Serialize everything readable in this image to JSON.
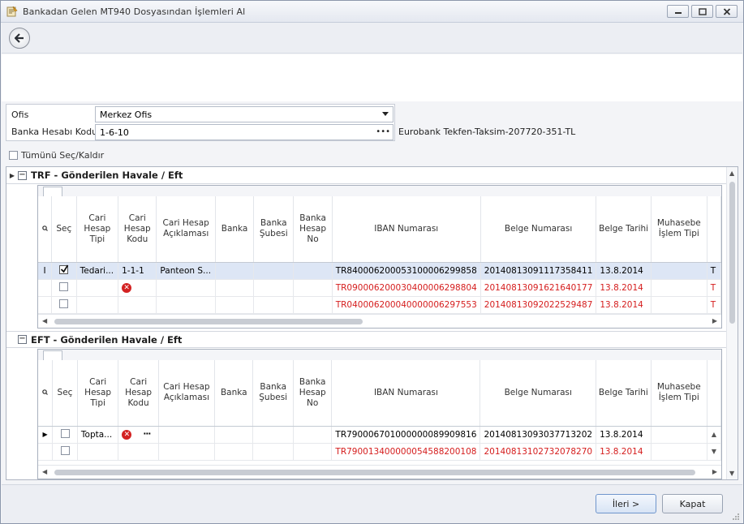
{
  "window": {
    "title": "Bankadan Gelen MT940 Dosyasından İşlemleri Al",
    "minimize": "—",
    "maximize": "□",
    "close": "✕"
  },
  "form": {
    "office_label": "Ofis",
    "office_value": "Merkez Ofis",
    "bank_account_label": "Banka Hesabı Kodu",
    "bank_account_value": "1-6-10",
    "bank_account_button": "•••",
    "bank_account_description": "Eurobank Tekfen-Taksim-207720-351-TL"
  },
  "select_all_label": "Tümünü Seç/Kaldır",
  "columns": {
    "sec": "Seç",
    "cari_tipi": "Cari Hesap Tipi",
    "cari_kodu": "Cari Hesap Kodu",
    "cari_aciklama": "Cari Hesap Açıklaması",
    "banka": "Banka",
    "banka_sube": "Banka Şubesi",
    "banka_hesap_no": "Banka Hesap No",
    "iban": "IBAN Numarası",
    "belge_no": "Belge Numarası",
    "belge_tarihi": "Belge Tarihi",
    "muhasebe_tipi": "Muhasebe İşlem Tipi"
  },
  "groups": [
    {
      "title": "TRF - Gönderilen Havale / Eft",
      "rows": [
        {
          "checked": true,
          "cari_tipi": "Tedari...",
          "cari_kodu": "1-1-1",
          "cari_aciklama": "Panteon S...",
          "iban": "TR840006200053100006299858",
          "belge_no": "20140813091117358411",
          "tarih": "13.8.2014",
          "extra": "T",
          "error": false,
          "red": false
        },
        {
          "checked": false,
          "cari_tipi": "",
          "cari_kodu": "",
          "cari_aciklama": "",
          "iban": "TR090006200030400006298804",
          "belge_no": "20140813091621640177",
          "tarih": "13.8.2014",
          "extra": "T",
          "error": true,
          "red": true
        },
        {
          "checked": false,
          "cari_tipi": "",
          "cari_kodu": "",
          "cari_aciklama": "",
          "iban": "TR040006200040000006297553",
          "belge_no": "20140813092022529487",
          "tarih": "13.8.2014",
          "extra": "T",
          "error": false,
          "red": true
        }
      ]
    },
    {
      "title": "EFT - Gönderilen Havale / Eft",
      "rows": [
        {
          "checked": false,
          "cari_tipi": "Topta...",
          "cari_kodu": "",
          "cari_aciklama": "",
          "iban": "TR790006701000000089909816",
          "belge_no": "20140813093037713202",
          "tarih": "13.8.2014",
          "extra": "",
          "error": true,
          "red": false
        },
        {
          "checked": false,
          "cari_tipi": "",
          "cari_kodu": "",
          "cari_aciklama": "",
          "iban": "TR790013400000054588200108",
          "belge_no": "20140813102732078270",
          "tarih": "13.8.2014",
          "extra": "",
          "error": false,
          "red": true
        }
      ]
    }
  ],
  "buttons": {
    "next": "İleri >",
    "close": "Kapat"
  }
}
